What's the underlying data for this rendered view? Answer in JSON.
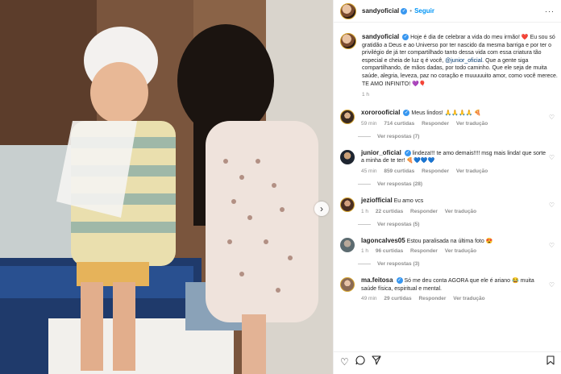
{
  "post": {
    "author": "sandyoficial",
    "follow_label": "Seguir",
    "menu_label": "···",
    "caption_lines": [
      "Hoje é dia de celebrar a vida do meu irmão! ❤️",
      "Eu sou só gratidão a Deus e ao Universo por ter nascido da mesma barriga e por ter o privilégio de já ter compartilhado tanto dessa vida com essa criatura tão especial e cheia de luz q é você,",
      "Que a gente siga compartilhando, de mãos dadas, por todo caminho. Que ele seja de muita saúde, alegria, leveza, paz no coração e muuuuuito amor, como você merece.",
      "TE AMO INFINITO! 💜🎈"
    ],
    "caption_mention": "@junior_oficial.",
    "caption_time": "1 h",
    "nav_next": "›"
  },
  "comments": [
    {
      "user": "xororooficial",
      "verified": true,
      "text": "Meus lindos! 🙏🙏🙏🙏 🍕",
      "time": "59 min",
      "likes": "714 curtidas",
      "reply": "Responder",
      "translate": "Ver tradução",
      "replies": "Ver respostas (7)"
    },
    {
      "user": "junior_oficial",
      "verified": true,
      "text": "lindeza!!! te amo demais!!!! msg mais linda! que sorte a minha de te ter! 🍕💙💙💙",
      "time": "45 min",
      "likes": "859 curtidas",
      "reply": "Responder",
      "translate": "Ver tradução",
      "replies": "Ver respostas (28)"
    },
    {
      "user": "jeziofficial",
      "verified": false,
      "text": "Eu amo vcs",
      "time": "1 h",
      "likes": "22 curtidas",
      "reply": "Responder",
      "translate": "Ver tradução",
      "replies": "Ver respostas (5)"
    },
    {
      "user": "lagoncalves05",
      "verified": false,
      "text": "Estou paralisada na última foto 😍",
      "time": "1 h",
      "likes": "96 curtidas",
      "reply": "Responder",
      "translate": "Ver tradução",
      "replies": "Ver respostas (3)"
    },
    {
      "user": "ma.feitosa",
      "verified": true,
      "text": "Só me deu conta AGORA que ele é ariano 😂 muita saúde física, espiritual e mental.",
      "time": "49 min",
      "likes": "29 curtidas",
      "reply": "Responder",
      "translate": "Ver tradução",
      "replies": ""
    }
  ],
  "icons": {
    "like": "heart-icon",
    "comment": "comment-icon",
    "share": "share-icon",
    "save": "bookmark-icon"
  },
  "colors": {
    "accent": "#0095f6",
    "verified": "#3897f0",
    "mention": "#00376b"
  }
}
